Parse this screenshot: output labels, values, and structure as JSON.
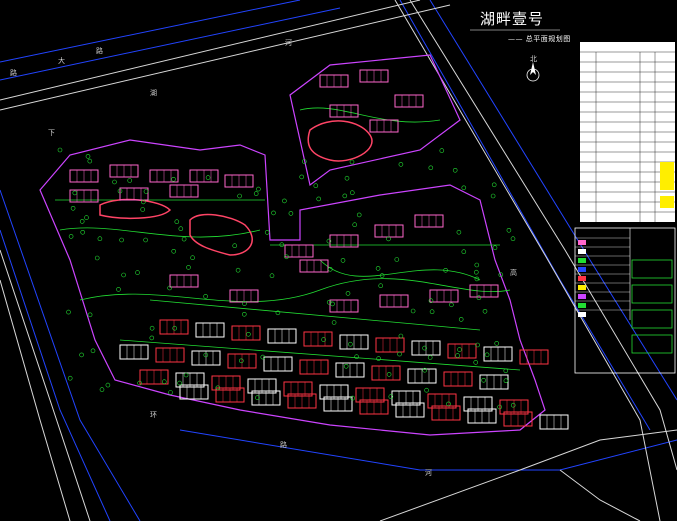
{
  "header": {
    "title": "湖畔壹号",
    "subtitle": "—— 总平面规划图"
  },
  "map_labels": {
    "north": "北",
    "road_top_left": [
      "路",
      "大",
      "路"
    ],
    "river_1": "河",
    "river_2": "湖",
    "river_3": "下",
    "south_1": "环",
    "south_2": "路",
    "south_3": "河",
    "right_road": "高"
  },
  "colors": {
    "background": "#000000",
    "building_pink": "#ff66cc",
    "building_white": "#ffffff",
    "terrace_red": "#ff3344",
    "landscape_green": "#22dd33",
    "road_blue": "#2244ff",
    "site_outline": "#cc44ff",
    "road_white": "#e0e0e0",
    "table_bg": "#ffffff"
  }
}
